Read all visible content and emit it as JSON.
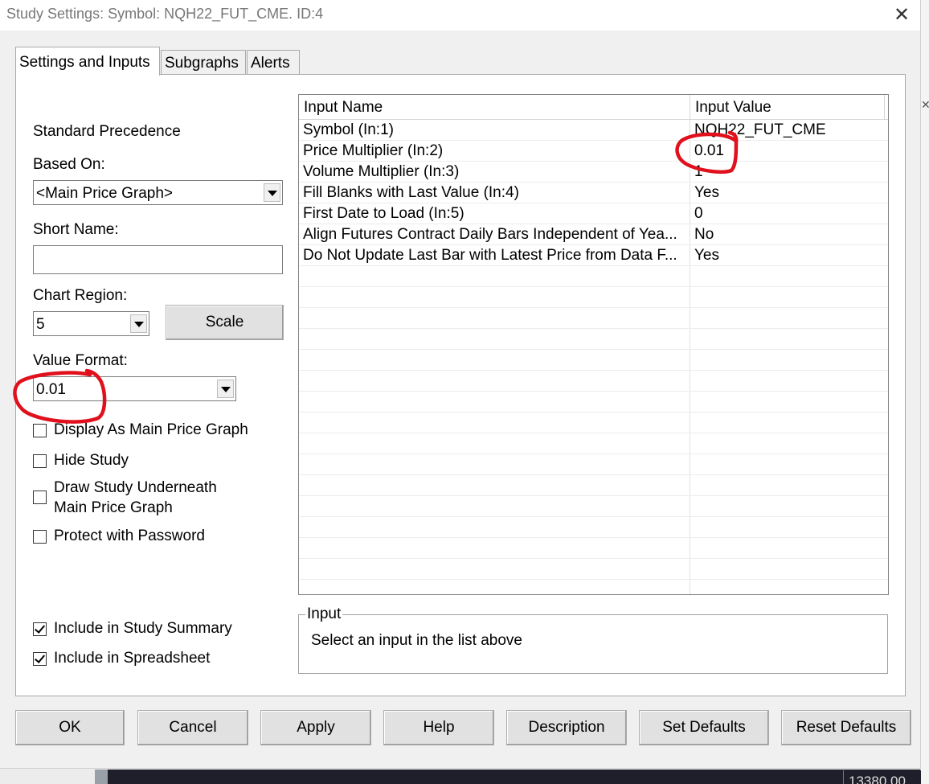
{
  "window": {
    "title": "Study Settings: Symbol: NQH22_FUT_CME. ID:4",
    "close_glyph": "✕"
  },
  "tabs": [
    {
      "label": "Settings and Inputs",
      "active": true
    },
    {
      "label": "Subgraphs",
      "active": false
    },
    {
      "label": "Alerts",
      "active": false
    }
  ],
  "left": {
    "standard_precedence": "Standard Precedence",
    "based_on_label": "Based On:",
    "based_on_value": "<Main Price Graph>",
    "short_name_label": "Short Name:",
    "short_name_value": "",
    "chart_region_label": "Chart Region:",
    "chart_region_value": "5",
    "scale_button": "Scale",
    "value_format_label": "Value Format:",
    "value_format_value": "0.01",
    "checkboxes": [
      {
        "label": "Display As Main Price Graph",
        "checked": false
      },
      {
        "label": "Hide Study",
        "checked": false
      },
      {
        "label": "Draw Study Underneath",
        "label2": "Main Price Graph",
        "checked": false
      },
      {
        "label": "Protect with Password",
        "checked": false
      },
      {
        "label": "Include in Study Summary",
        "checked": true
      },
      {
        "label": "Include in Spreadsheet",
        "checked": true
      }
    ]
  },
  "inputs_table": {
    "columns": [
      "Input Name",
      "Input Value"
    ],
    "rows": [
      {
        "name": "Symbol   (In:1)",
        "value": "NQH22_FUT_CME"
      },
      {
        "name": "Price Multiplier   (In:2)",
        "value": "0.01"
      },
      {
        "name": "Volume Multiplier   (In:3)",
        "value": "1"
      },
      {
        "name": "Fill Blanks with Last Value   (In:4)",
        "value": "Yes"
      },
      {
        "name": "First Date to Load   (In:5)",
        "value": "0"
      },
      {
        "name": "Align Futures Contract Daily Bars Independent of Yea...",
        "value": "No"
      },
      {
        "name": "Do Not Update Last Bar with Latest Price from Data F...",
        "value": "Yes"
      }
    ]
  },
  "input_group": {
    "legend": "Input",
    "text": "Select an input in the list above"
  },
  "buttons": [
    "OK",
    "Cancel",
    "Apply",
    "Help",
    "Description",
    "Set Defaults",
    "Reset Defaults"
  ],
  "background_chart": {
    "price_label": "13380.00"
  },
  "annotation_color": "#e0101c"
}
